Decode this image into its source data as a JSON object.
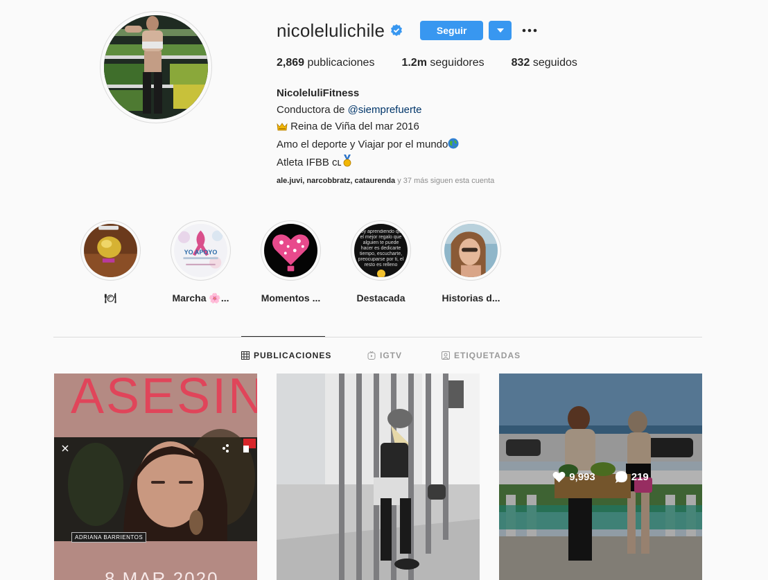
{
  "profile": {
    "username": "nicolelulichile",
    "follow_label": "Seguir",
    "stats": {
      "posts_count": "2,869",
      "posts_label": "publicaciones",
      "followers_count": "1.2m",
      "followers_label": "seguidores",
      "following_count": "832",
      "following_label": "seguidos"
    },
    "bio": {
      "name": "NicoleluliFitness",
      "line1_prefix": "Conductora de ",
      "line1_mention": "@siemprefuerte",
      "line2": " Reina de Viña del mar 2016",
      "line3": "Amo el deporte y Viajar por el mundo",
      "line4": "Atleta IFBB ᴄʟ"
    },
    "followed_by": {
      "names": "ale.juvi, narcobbratz, cataurenda",
      "suffix": " y 37 más siguen esta cuenta"
    }
  },
  "highlights": [
    {
      "label": "🍽",
      "icon": "food-icon"
    },
    {
      "label": "Marcha 🌸...",
      "icon": "pink-ribbon"
    },
    {
      "label": "Momentos ...",
      "icon": "heart-collage"
    },
    {
      "label": "Destacada",
      "icon": "text-quote"
    },
    {
      "label": "Historias d...",
      "icon": "selfie"
    }
  ],
  "highlight_image_text": {
    "yo_apoyo": "YO APOYO",
    "quote": "Voy aprendiendo que el mejor regalo que alguien te puede hacer es dedicarte tiempo, escucharte, preocuparse por ti, el resto es relleno"
  },
  "tabs": [
    {
      "label": "PUBLICACIONES",
      "icon": "grid-icon",
      "active": true
    },
    {
      "label": "IGTV",
      "icon": "igtv-icon",
      "active": false
    },
    {
      "label": "ETIQUETADAS",
      "icon": "tagged-icon",
      "active": false
    }
  ],
  "posts": [
    {
      "headline": "ASESINA",
      "caption_name": "ADRIANA BARRIENTOS",
      "date_text": "8 MAR 2020"
    },
    {},
    {
      "likes": "9,993",
      "comments": "219"
    }
  ],
  "colors": {
    "accent": "#3897f0",
    "mention": "#003569",
    "text": "#262626",
    "muted": "#8e8e8e",
    "border": "#dbdbdb"
  }
}
